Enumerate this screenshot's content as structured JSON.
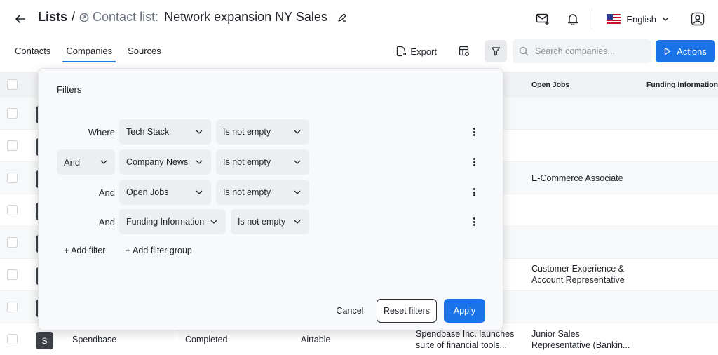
{
  "header": {
    "root_label": "Lists",
    "separator": "/",
    "list_type": "Contact list:",
    "list_name": "Network expansion NY Sales",
    "language": "English"
  },
  "tabs": [
    {
      "label": "Contacts",
      "active": false
    },
    {
      "label": "Companies",
      "active": true
    },
    {
      "label": "Sources",
      "active": false
    }
  ],
  "toolbar": {
    "export_label": "Export",
    "search_placeholder": "Search companies...",
    "actions_label": "Actions"
  },
  "table": {
    "columns": [
      "Open Jobs",
      "Funding Information"
    ],
    "rows": [
      {
        "avatar": "",
        "name": "",
        "status": "",
        "tech": "",
        "news": "",
        "jobs": ""
      },
      {
        "avatar": "",
        "name": "",
        "status": "",
        "tech": "",
        "news": "",
        "jobs": ""
      },
      {
        "avatar": "",
        "name": "",
        "status": "",
        "tech": "",
        "news": "",
        "jobs": "E-Commerce Associate"
      },
      {
        "avatar": "",
        "name": "",
        "status": "",
        "tech": "",
        "news": "",
        "jobs": ""
      },
      {
        "avatar": "",
        "name": "",
        "status": "",
        "tech": "",
        "news": "",
        "jobs": ""
      },
      {
        "avatar": "",
        "name": "",
        "status": "",
        "tech": "",
        "news": "",
        "jobs_line1": "Customer Experience &",
        "jobs_line2": "Account Representative"
      },
      {
        "avatar": "",
        "name": "",
        "status": "",
        "tech": "",
        "news": "",
        "jobs": ""
      },
      {
        "avatar": "S",
        "name": "Spendbase",
        "status": "Completed",
        "tech": "Airtable",
        "news_line1": "Spendbase Inc. launches",
        "news_line2": "suite of financial tools...",
        "jobs_line1": "Junior Sales",
        "jobs_line2": "Representative (Bankin..."
      }
    ]
  },
  "filters": {
    "title": "Filters",
    "rows": [
      {
        "conjunction": "Where",
        "field": "Tech Stack",
        "operator": "Is not empty"
      },
      {
        "conjunction": "And",
        "field": "Company News",
        "operator": "Is not empty"
      },
      {
        "conjunction": "And",
        "field": "Open Jobs",
        "operator": "Is not empty"
      },
      {
        "conjunction": "And",
        "field": "Funding Information",
        "operator": "Is not empty"
      }
    ],
    "add_filter": "+ Add filter",
    "add_filter_group": "+ Add filter group",
    "cancel": "Cancel",
    "reset": "Reset filters",
    "apply": "Apply"
  },
  "colors": {
    "accent": "#1a73e8",
    "header_bg": "#f1f2f4",
    "select_bg": "#eceef1"
  }
}
